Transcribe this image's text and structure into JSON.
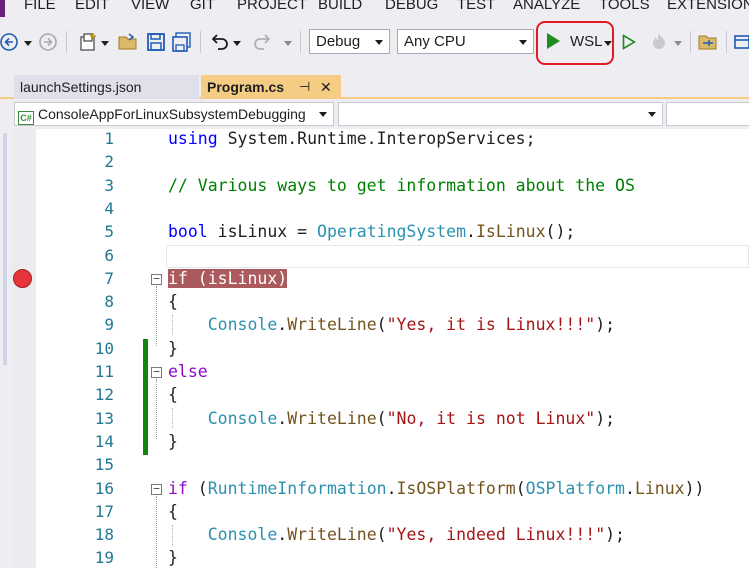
{
  "menu": {
    "items": [
      "FILE",
      "EDIT",
      "VIEW",
      "GIT",
      "PROJECT",
      "BUILD",
      "DEBUG",
      "TEST",
      "ANALYZE",
      "TOOLS",
      "EXTENSIONS"
    ]
  },
  "toolbar": {
    "configuration": "Debug",
    "platform": "Any CPU",
    "run_target": "WSL",
    "icons": [
      "back-arrow",
      "forward-arrow",
      "new-item",
      "open-folder",
      "save",
      "save-all",
      "undo",
      "redo",
      "play",
      "play-outline",
      "hot-reload",
      "solution-explorer",
      "extra"
    ],
    "highlight_color": "#e01b24"
  },
  "tabs": [
    {
      "label": "launchSettings.json",
      "active": false
    },
    {
      "label": "Program.cs",
      "active": true,
      "pin": "⊣",
      "close": "✕"
    }
  ],
  "navbar": {
    "project": "ConsoleAppForLinuxSubsystemDebugging",
    "member": ""
  },
  "editor": {
    "breakpoint_line": 7,
    "lines": [
      {
        "n": "1",
        "tokens": [
          [
            "kw",
            "using"
          ],
          [
            "",
            " System.Runtime.InteropServices;"
          ]
        ]
      },
      {
        "n": "2",
        "tokens": []
      },
      {
        "n": "3",
        "tokens": [
          [
            "cmt",
            "// Various ways to get information about the OS"
          ]
        ]
      },
      {
        "n": "4",
        "tokens": []
      },
      {
        "n": "5",
        "tokens": [
          [
            "kw",
            "bool"
          ],
          [
            "",
            " isLinux = "
          ],
          [
            "type",
            "OperatingSystem"
          ],
          [
            "",
            "."
          ],
          [
            "method",
            "IsLinux"
          ],
          [
            "",
            "();"
          ]
        ]
      },
      {
        "n": "6",
        "tokens": []
      },
      {
        "n": "7",
        "tokens": [
          [
            "bpline",
            "if (isLinux)"
          ]
        ]
      },
      {
        "n": "8",
        "tokens": [
          [
            "",
            "{"
          ]
        ]
      },
      {
        "n": "9",
        "tokens": [
          [
            "",
            "    "
          ],
          [
            "type",
            "Console"
          ],
          [
            "",
            "."
          ],
          [
            "method",
            "WriteLine"
          ],
          [
            "",
            "("
          ],
          [
            "str",
            "\"Yes, it is Linux!!!\""
          ],
          [
            "",
            ");"
          ]
        ]
      },
      {
        "n": "10",
        "tokens": [
          [
            "",
            "}"
          ]
        ]
      },
      {
        "n": "11",
        "tokens": [
          [
            "ctrl",
            "else"
          ]
        ]
      },
      {
        "n": "12",
        "tokens": [
          [
            "",
            "{"
          ]
        ]
      },
      {
        "n": "13",
        "tokens": [
          [
            "",
            "    "
          ],
          [
            "type",
            "Console"
          ],
          [
            "",
            "."
          ],
          [
            "method",
            "WriteLine"
          ],
          [
            "",
            "("
          ],
          [
            "str",
            "\"No, it is not Linux\""
          ],
          [
            "",
            ");"
          ]
        ]
      },
      {
        "n": "14",
        "tokens": [
          [
            "",
            "}"
          ]
        ]
      },
      {
        "n": "15",
        "tokens": []
      },
      {
        "n": "16",
        "tokens": [
          [
            "ctrl",
            "if"
          ],
          [
            "",
            " ("
          ],
          [
            "type",
            "RuntimeInformation"
          ],
          [
            "",
            "."
          ],
          [
            "method",
            "IsOSPlatform"
          ],
          [
            "",
            "("
          ],
          [
            "type",
            "OSPlatform"
          ],
          [
            "",
            "."
          ],
          [
            "method",
            "Linux"
          ],
          [
            "",
            "))"
          ]
        ]
      },
      {
        "n": "17",
        "tokens": [
          [
            "",
            "{"
          ]
        ]
      },
      {
        "n": "18",
        "tokens": [
          [
            "",
            "    "
          ],
          [
            "type",
            "Console"
          ],
          [
            "",
            "."
          ],
          [
            "method",
            "WriteLine"
          ],
          [
            "",
            "("
          ],
          [
            "str",
            "\"Yes, indeed Linux!!!\""
          ],
          [
            "",
            ");"
          ]
        ]
      },
      {
        "n": "19",
        "tokens": [
          [
            "",
            "}"
          ]
        ]
      }
    ]
  }
}
